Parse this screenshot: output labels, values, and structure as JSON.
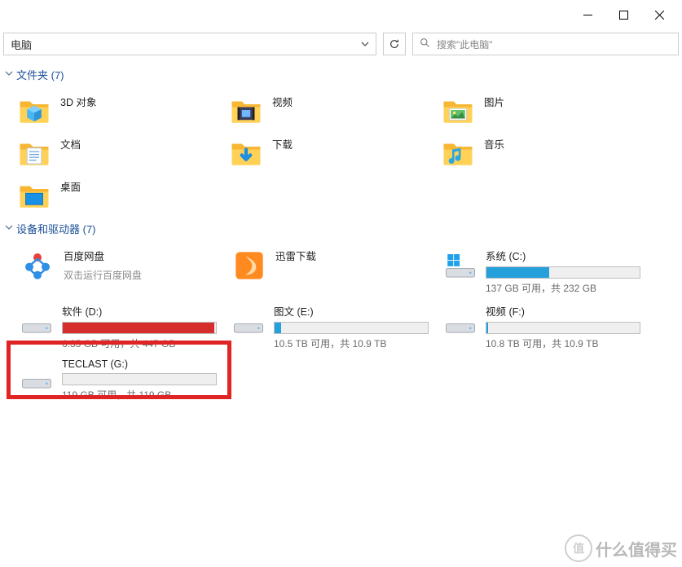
{
  "breadcrumb": {
    "path": "电脑"
  },
  "search": {
    "placeholder": "搜索\"此电脑\""
  },
  "groups": {
    "folders": {
      "title": "文件夹 (7)"
    },
    "drives": {
      "title": "设备和驱动器 (7)"
    }
  },
  "folders": [
    {
      "name": "3D 对象",
      "icon": "3d"
    },
    {
      "name": "视频",
      "icon": "video"
    },
    {
      "name": "图片",
      "icon": "pictures"
    },
    {
      "name": "文档",
      "icon": "documents"
    },
    {
      "name": "下载",
      "icon": "downloads"
    },
    {
      "name": "音乐",
      "icon": "music"
    },
    {
      "name": "桌面",
      "icon": "desktop"
    }
  ],
  "drives": [
    {
      "name": "百度网盘",
      "sub": "双击运行百度网盘",
      "icon": "baidu"
    },
    {
      "name": "迅雷下载",
      "icon": "xunlei"
    },
    {
      "name": "系统 (C:)",
      "stat": "137 GB 可用，共 232 GB",
      "fill": 41,
      "color": "blue",
      "icon": "sysdrive"
    },
    {
      "name": "软件 (D:)",
      "stat": "6.35 GB 可用，共 447 GB",
      "fill": 99,
      "color": "red",
      "icon": "drive",
      "highlight": false
    },
    {
      "name": "图文 (E:)",
      "stat": "10.5 TB 可用，共 10.9 TB",
      "fill": 4,
      "color": "blue",
      "icon": "drive"
    },
    {
      "name": "视频 (F:)",
      "stat": "10.8 TB 可用，共 10.9 TB",
      "fill": 1,
      "color": "blue",
      "icon": "drive"
    },
    {
      "name": "TECLAST (G:)",
      "stat": "119 GB 可用，共 119 GB",
      "fill": 0,
      "color": "blue",
      "icon": "drive",
      "highlight": true
    }
  ],
  "watermark": {
    "text": "什么值得买",
    "badge": "值"
  }
}
